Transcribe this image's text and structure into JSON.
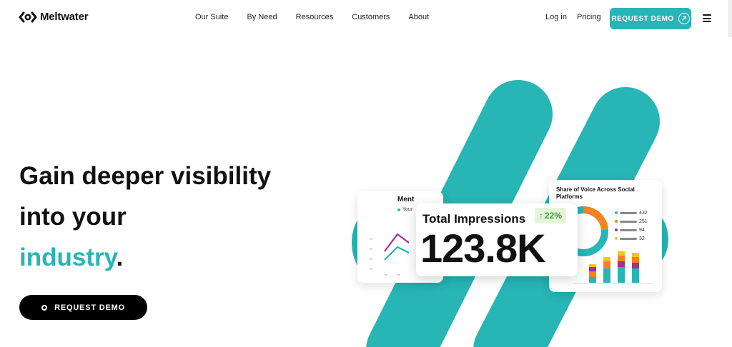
{
  "brand": {
    "name": "Meltwater",
    "accent": "#27b5b5"
  },
  "nav": {
    "items": [
      "Our Suite",
      "By Need",
      "Resources",
      "Customers",
      "About"
    ],
    "login": "Log in",
    "pricing": "Pricing",
    "demo_label": "REQUEST DEMO"
  },
  "hero": {
    "line1": "Gain deeper visibility",
    "line2": "into your",
    "line3_highlight": "industry",
    "line3_tail": ".",
    "cta_label": "REQUEST DEMO"
  },
  "cards": {
    "mentions": {
      "title": "Ment",
      "legend": "Your"
    },
    "impressions": {
      "title": "Total Impressions",
      "change": "22%",
      "value": "123.8K"
    },
    "share_of_voice": {
      "title": "Share of Voice Across Social Platforms",
      "legend": [
        {
          "color": "#27b5b5",
          "value": "432"
        },
        {
          "color": "#f5821f",
          "value": "251"
        },
        {
          "color": "#a0308e",
          "value": "94"
        },
        {
          "color": "#f5c518",
          "value": "32"
        }
      ]
    }
  },
  "icons": {
    "menu": "hamburger-icon",
    "arrow": "arrow-up-right-icon",
    "cta": "circle-icon"
  }
}
